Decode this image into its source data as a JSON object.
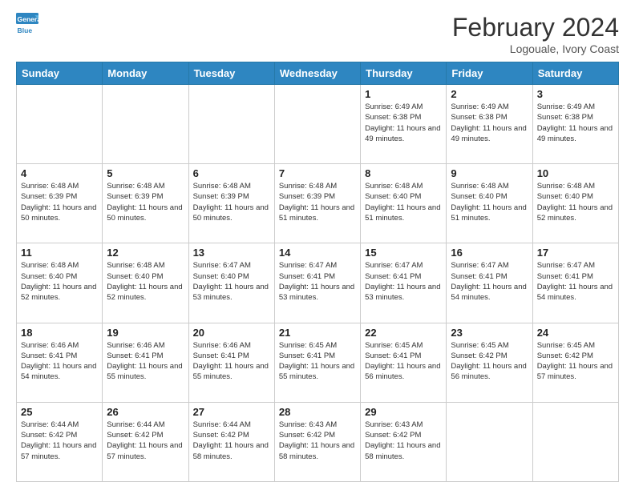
{
  "header": {
    "logo_line1": "General",
    "logo_line2": "Blue",
    "month_year": "February 2024",
    "location": "Logouale, Ivory Coast"
  },
  "weekdays": [
    "Sunday",
    "Monday",
    "Tuesday",
    "Wednesday",
    "Thursday",
    "Friday",
    "Saturday"
  ],
  "weeks": [
    [
      {
        "day": "",
        "info": ""
      },
      {
        "day": "",
        "info": ""
      },
      {
        "day": "",
        "info": ""
      },
      {
        "day": "",
        "info": ""
      },
      {
        "day": "1",
        "info": "Sunrise: 6:49 AM\nSunset: 6:38 PM\nDaylight: 11 hours\nand 49 minutes."
      },
      {
        "day": "2",
        "info": "Sunrise: 6:49 AM\nSunset: 6:38 PM\nDaylight: 11 hours\nand 49 minutes."
      },
      {
        "day": "3",
        "info": "Sunrise: 6:49 AM\nSunset: 6:38 PM\nDaylight: 11 hours\nand 49 minutes."
      }
    ],
    [
      {
        "day": "4",
        "info": "Sunrise: 6:48 AM\nSunset: 6:39 PM\nDaylight: 11 hours\nand 50 minutes."
      },
      {
        "day": "5",
        "info": "Sunrise: 6:48 AM\nSunset: 6:39 PM\nDaylight: 11 hours\nand 50 minutes."
      },
      {
        "day": "6",
        "info": "Sunrise: 6:48 AM\nSunset: 6:39 PM\nDaylight: 11 hours\nand 50 minutes."
      },
      {
        "day": "7",
        "info": "Sunrise: 6:48 AM\nSunset: 6:39 PM\nDaylight: 11 hours\nand 51 minutes."
      },
      {
        "day": "8",
        "info": "Sunrise: 6:48 AM\nSunset: 6:40 PM\nDaylight: 11 hours\nand 51 minutes."
      },
      {
        "day": "9",
        "info": "Sunrise: 6:48 AM\nSunset: 6:40 PM\nDaylight: 11 hours\nand 51 minutes."
      },
      {
        "day": "10",
        "info": "Sunrise: 6:48 AM\nSunset: 6:40 PM\nDaylight: 11 hours\nand 52 minutes."
      }
    ],
    [
      {
        "day": "11",
        "info": "Sunrise: 6:48 AM\nSunset: 6:40 PM\nDaylight: 11 hours\nand 52 minutes."
      },
      {
        "day": "12",
        "info": "Sunrise: 6:48 AM\nSunset: 6:40 PM\nDaylight: 11 hours\nand 52 minutes."
      },
      {
        "day": "13",
        "info": "Sunrise: 6:47 AM\nSunset: 6:40 PM\nDaylight: 11 hours\nand 53 minutes."
      },
      {
        "day": "14",
        "info": "Sunrise: 6:47 AM\nSunset: 6:41 PM\nDaylight: 11 hours\nand 53 minutes."
      },
      {
        "day": "15",
        "info": "Sunrise: 6:47 AM\nSunset: 6:41 PM\nDaylight: 11 hours\nand 53 minutes."
      },
      {
        "day": "16",
        "info": "Sunrise: 6:47 AM\nSunset: 6:41 PM\nDaylight: 11 hours\nand 54 minutes."
      },
      {
        "day": "17",
        "info": "Sunrise: 6:47 AM\nSunset: 6:41 PM\nDaylight: 11 hours\nand 54 minutes."
      }
    ],
    [
      {
        "day": "18",
        "info": "Sunrise: 6:46 AM\nSunset: 6:41 PM\nDaylight: 11 hours\nand 54 minutes."
      },
      {
        "day": "19",
        "info": "Sunrise: 6:46 AM\nSunset: 6:41 PM\nDaylight: 11 hours\nand 55 minutes."
      },
      {
        "day": "20",
        "info": "Sunrise: 6:46 AM\nSunset: 6:41 PM\nDaylight: 11 hours\nand 55 minutes."
      },
      {
        "day": "21",
        "info": "Sunrise: 6:45 AM\nSunset: 6:41 PM\nDaylight: 11 hours\nand 55 minutes."
      },
      {
        "day": "22",
        "info": "Sunrise: 6:45 AM\nSunset: 6:41 PM\nDaylight: 11 hours\nand 56 minutes."
      },
      {
        "day": "23",
        "info": "Sunrise: 6:45 AM\nSunset: 6:42 PM\nDaylight: 11 hours\nand 56 minutes."
      },
      {
        "day": "24",
        "info": "Sunrise: 6:45 AM\nSunset: 6:42 PM\nDaylight: 11 hours\nand 57 minutes."
      }
    ],
    [
      {
        "day": "25",
        "info": "Sunrise: 6:44 AM\nSunset: 6:42 PM\nDaylight: 11 hours\nand 57 minutes."
      },
      {
        "day": "26",
        "info": "Sunrise: 6:44 AM\nSunset: 6:42 PM\nDaylight: 11 hours\nand 57 minutes."
      },
      {
        "day": "27",
        "info": "Sunrise: 6:44 AM\nSunset: 6:42 PM\nDaylight: 11 hours\nand 58 minutes."
      },
      {
        "day": "28",
        "info": "Sunrise: 6:43 AM\nSunset: 6:42 PM\nDaylight: 11 hours\nand 58 minutes."
      },
      {
        "day": "29",
        "info": "Sunrise: 6:43 AM\nSunset: 6:42 PM\nDaylight: 11 hours\nand 58 minutes."
      },
      {
        "day": "",
        "info": ""
      },
      {
        "day": "",
        "info": ""
      }
    ]
  ]
}
